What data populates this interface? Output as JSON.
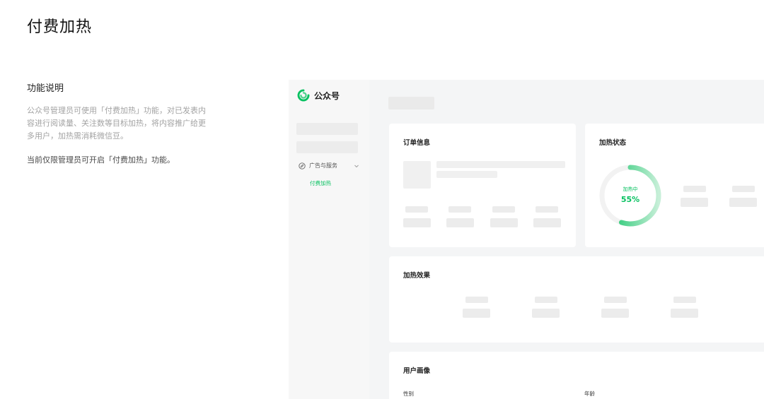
{
  "page": {
    "title": "付费加热"
  },
  "description": {
    "heading": "功能说明",
    "body": "公众号管理员可使用「付费加热」功能，对已发表内容进行阅读量、关注数等目标加热，将内容推广给更多用户，加热需消耗微信豆。",
    "note": "当前仅限管理员可开启「付费加热」功能。"
  },
  "mockup": {
    "brand": {
      "name": "公众号",
      "icon": "wechat-official-account-logo-icon"
    },
    "sidebar": {
      "group_label": "广告与服务",
      "group_icon": "compass-icon",
      "active_item": "付费加热"
    },
    "cards": {
      "order_info": "订单信息",
      "heat_status": "加热状态",
      "heat_effect": "加热效果",
      "user_profile": "用户画像"
    },
    "progress": {
      "label": "加热中",
      "value_text": "55%",
      "fraction": 0.55
    },
    "profile_fields": {
      "gender": "性别",
      "age": "年龄"
    },
    "colors": {
      "accent": "#07c160"
    }
  }
}
